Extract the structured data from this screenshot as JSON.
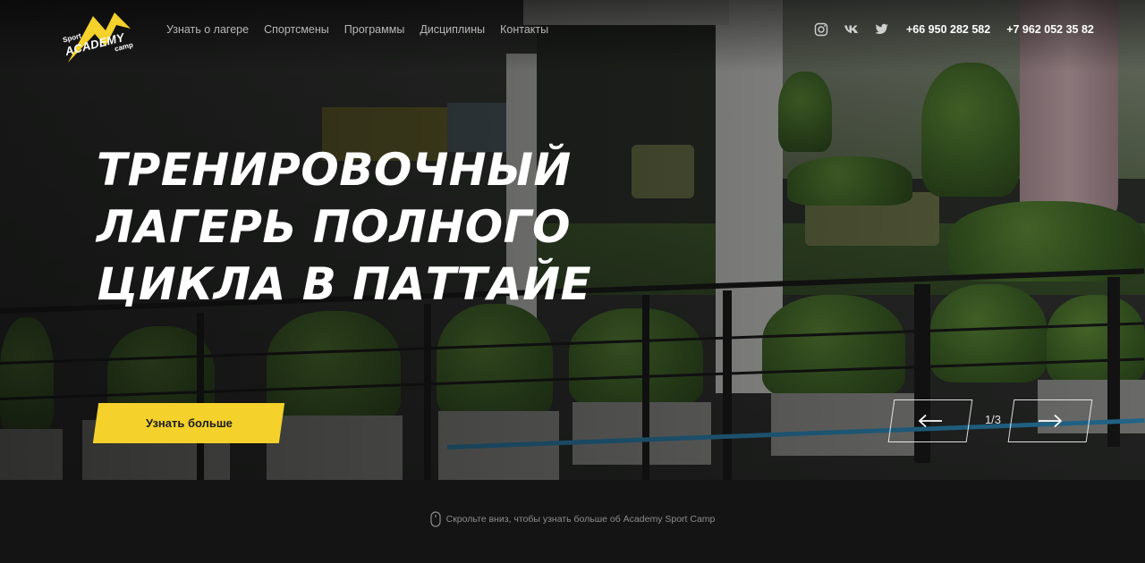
{
  "brand": {
    "logo_top": "Sport",
    "logo_main": "ACADEMY",
    "logo_bottom": "camp",
    "accent_color": "#f4d12b"
  },
  "nav": {
    "items": [
      {
        "label": "Узнать о лагере"
      },
      {
        "label": "Спортсмены"
      },
      {
        "label": "Программы"
      },
      {
        "label": "Дисциплины"
      },
      {
        "label": "Контакты"
      }
    ]
  },
  "social": {
    "icons": [
      "instagram-icon",
      "vk-icon",
      "twitter-icon"
    ]
  },
  "phones": [
    "+66 950 282 582",
    "+7 962 052 35 82"
  ],
  "hero": {
    "title_lines": [
      "ТРЕНИРОВОЧНЫЙ",
      "ЛАГЕРЬ ПОЛНОГО",
      "ЦИКЛА В ПАТТАЙЕ"
    ],
    "cta_label": "Узнать больше"
  },
  "slider": {
    "counter": "1/3",
    "prev_icon": "arrow-left-icon",
    "next_icon": "arrow-right-icon"
  },
  "scroll_hint": {
    "icon": "mouse-icon",
    "text": "Скрольте вниз, чтобы узнать больше об Academy Sport Camp"
  }
}
